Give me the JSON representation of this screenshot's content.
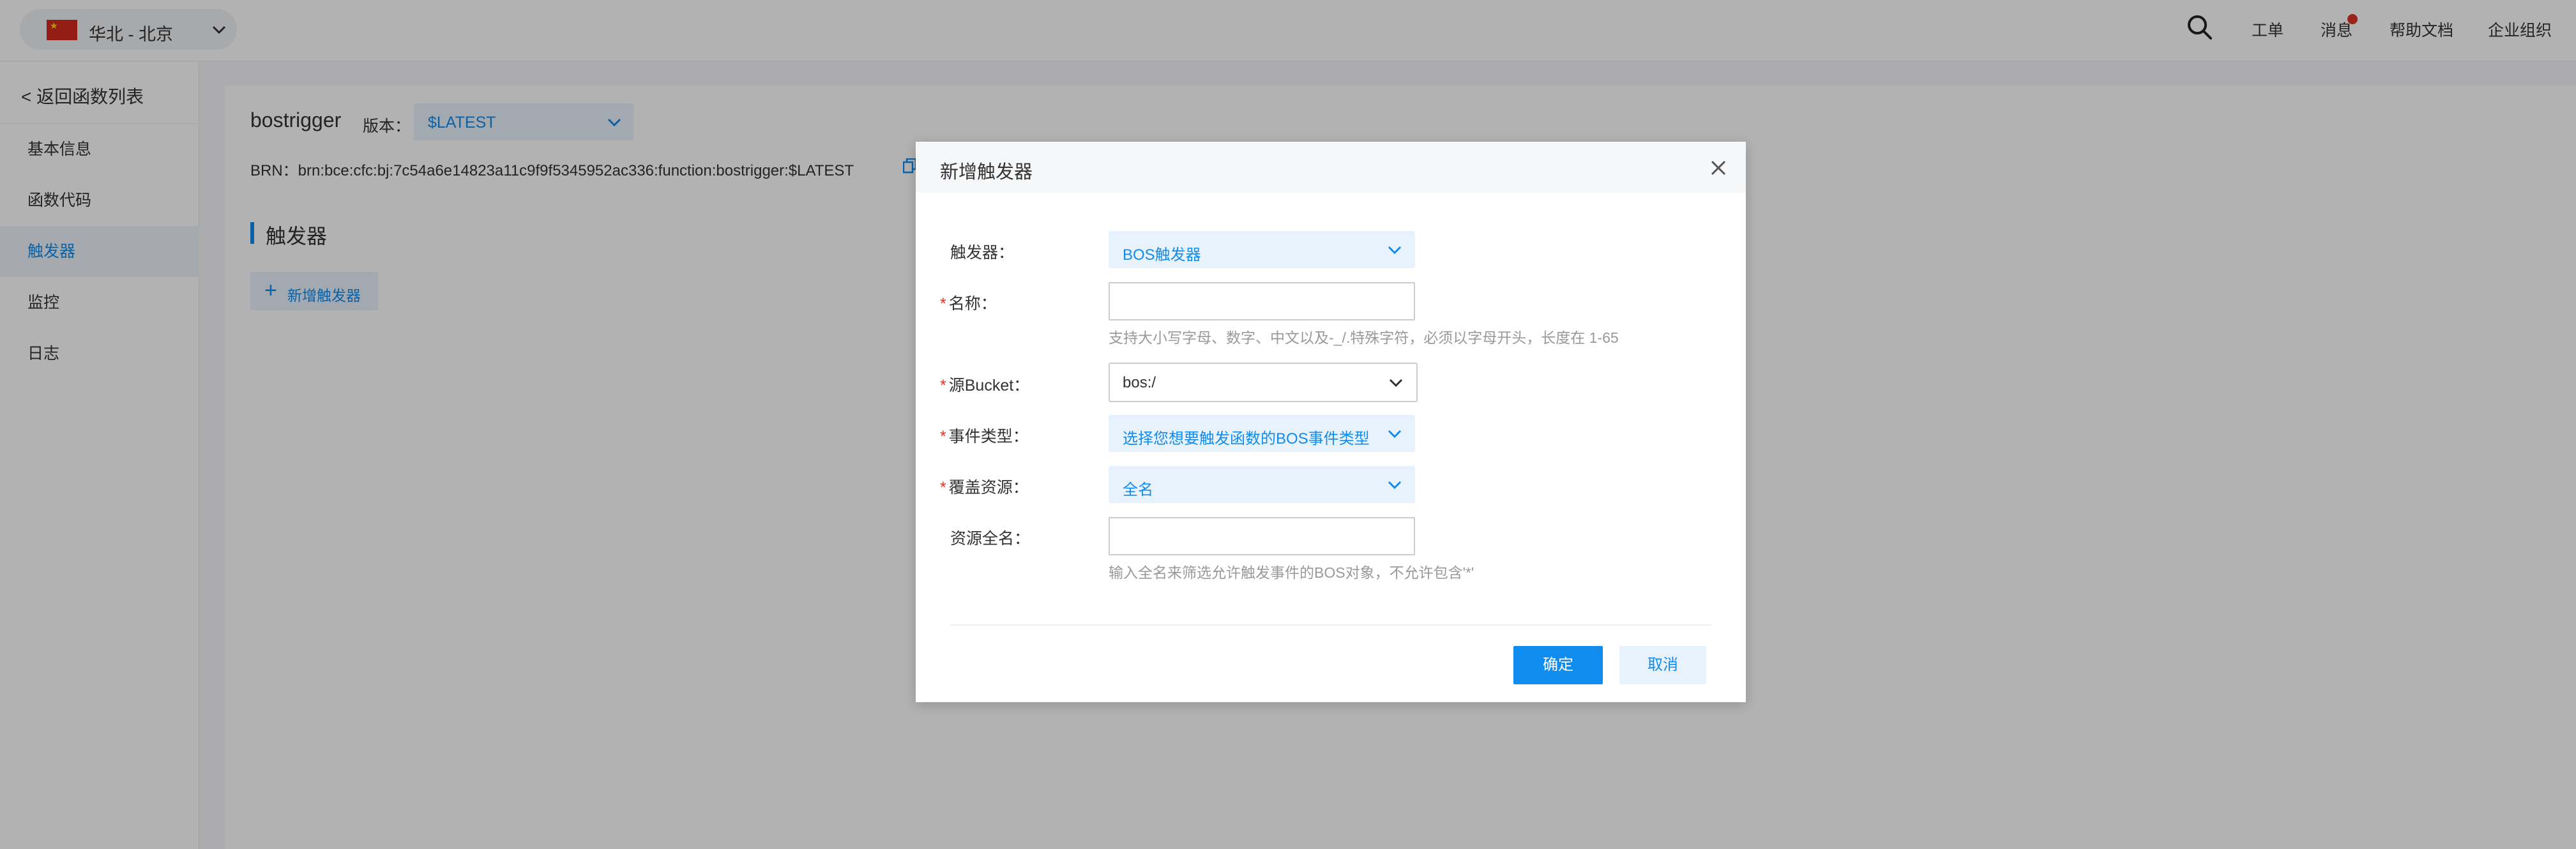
{
  "topbar": {
    "region_label": "华北 - 北京",
    "links": {
      "ticket": "工单",
      "messages": "消息",
      "help_docs": "帮助文档",
      "enterprise": "企业组织"
    }
  },
  "sidenav": {
    "back_label": "< 返回函数列表",
    "items": [
      {
        "label": "基本信息"
      },
      {
        "label": "函数代码"
      },
      {
        "label": "触发器",
        "active": true
      },
      {
        "label": "监控"
      },
      {
        "label": "日志"
      }
    ]
  },
  "function": {
    "name": "bostrigger",
    "version_label": "版本：",
    "version_value": "$LATEST",
    "brn": "BRN：brn:bce:cfc:bj:7c54a6e14823a11c9f9f5345952ac336:function:bostrigger:$LATEST"
  },
  "triggers": {
    "section_title": "触发器",
    "add_button": "新增触发器"
  },
  "modal": {
    "title": "新增触发器",
    "fields": {
      "trigger": {
        "label": "触发器：",
        "value": "BOS触发器"
      },
      "name": {
        "label": "名称：",
        "value": "",
        "hint": "支持大小写字母、数字、中文以及-_/.特殊字符，必须以字母开头，长度在 1-65"
      },
      "bucket": {
        "label": "源Bucket：",
        "value": "bos:/"
      },
      "event_type": {
        "label": "事件类型：",
        "value": "选择您想要触发函数的BOS事件类型"
      },
      "resource": {
        "label": "覆盖资源：",
        "value": "全名"
      },
      "resource_name": {
        "label": "资源全名：",
        "value": "",
        "hint": "输入全名来筛选允许触发事件的BOS对象，不允许包含'*'"
      }
    },
    "ok_button": "确定",
    "cancel_button": "取消"
  },
  "colors": {
    "accent": "#108cee",
    "required": "#e0312c",
    "overlay": "rgba(0,0,0,0.30)"
  }
}
